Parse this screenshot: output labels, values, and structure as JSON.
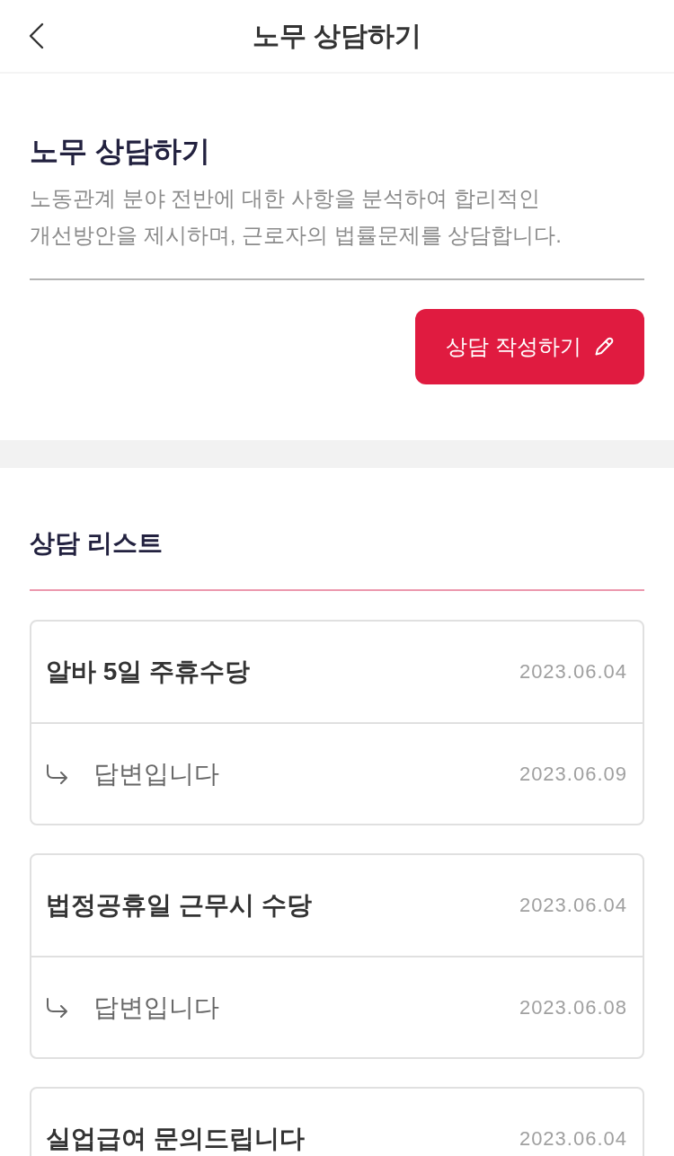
{
  "header": {
    "title": "노무 상담하기"
  },
  "intro": {
    "title": "노무 상담하기",
    "description": "노동관계 분야 전반에 대한 사항을 분석하여 합리적인 개선방안을 제시하며, 근로자의 법률문제를 상담합니다.",
    "write_button": "상담 작성하기"
  },
  "list": {
    "title": "상담 리스트",
    "items": [
      {
        "title": "알바 5일 주휴수당",
        "date": "2023.06.04",
        "reply": {
          "text": "답변입니다",
          "date": "2023.06.09"
        }
      },
      {
        "title": "법정공휴일 근무시 수당",
        "date": "2023.06.04",
        "reply": {
          "text": "답변입니다",
          "date": "2023.06.08"
        }
      },
      {
        "title": "실업급여 문의드립니다",
        "date": "2023.06.04"
      }
    ]
  }
}
